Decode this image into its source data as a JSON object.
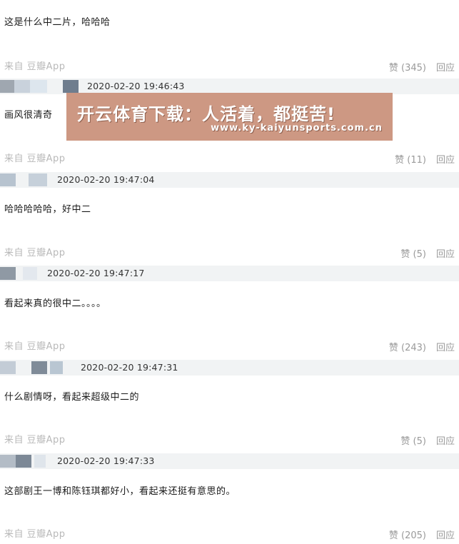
{
  "watermark": {
    "title": "开云体育下载：人活着，都挺苦!",
    "url": "www.ky-kaiyunsports.com.cn"
  },
  "comments": [
    {
      "text": "这是什么中二片，哈哈哈",
      "source": "来自 豆瓣App",
      "likes": "赞 (345)",
      "reply": "回应"
    },
    {
      "time": "2020-02-20 19:46:43",
      "text": "画风很清奇",
      "source": "来自 豆瓣App",
      "likes": "赞 (11)",
      "reply": "回应"
    },
    {
      "time": "2020-02-20 19:47:04",
      "text": "哈哈哈哈哈，好中二",
      "source": "来自 豆瓣App",
      "likes": "赞 (5)",
      "reply": "回应"
    },
    {
      "time": "2020-02-20 19:47:17",
      "text": "看起来真的很中二。。。。",
      "source": "来自 豆瓣App",
      "likes": "赞 (243)",
      "reply": "回应"
    },
    {
      "time": "2020-02-20 19:47:31",
      "text": "什么剧情呀，看起来超级中二的",
      "source": "来自 豆瓣App",
      "likes": "赞 (5)",
      "reply": "回应"
    },
    {
      "time": "2020-02-20 19:47:33",
      "text": "这部剧王一博和陈钰琪都好小，看起来还挺有意思的。",
      "source": "来自 豆瓣App",
      "likes": "赞 (205)",
      "reply": "回应"
    }
  ]
}
